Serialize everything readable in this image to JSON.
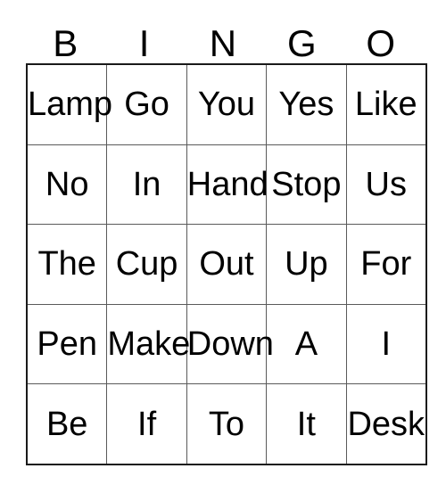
{
  "card": {
    "title": "BINGO",
    "headers": [
      "B",
      "I",
      "N",
      "G",
      "O"
    ],
    "rows": [
      [
        "Lamp",
        "Go",
        "You",
        "Yes",
        "Like"
      ],
      [
        "No",
        "In",
        "Hand",
        "Stop",
        "Us"
      ],
      [
        "The",
        "Cup",
        "Out",
        "Up",
        "For"
      ],
      [
        "Pen",
        "Make",
        "Down",
        "A",
        "I"
      ],
      [
        "Be",
        "If",
        "To",
        "It",
        "Desk"
      ]
    ],
    "colors": {
      "text": "#000000",
      "background": "#ffffff",
      "outer_border": "#1a1a1a",
      "inner_border": "#5a5a5a"
    }
  }
}
